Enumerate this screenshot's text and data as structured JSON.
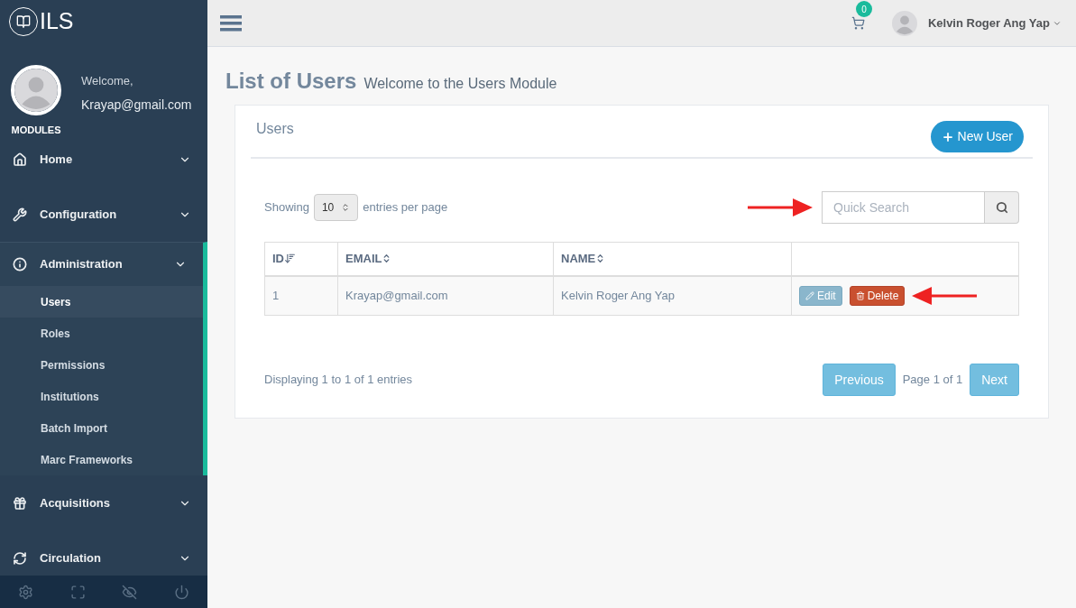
{
  "brand": "ILS",
  "profile": {
    "greeting": "Welcome,",
    "email": "Krayap@gmail.com",
    "section": "MODULES"
  },
  "nav": [
    {
      "label": "Home",
      "expanded": false
    },
    {
      "label": "Configuration",
      "expanded": false
    },
    {
      "label": "Administration",
      "expanded": true,
      "children": [
        {
          "label": "Users",
          "selected": true
        },
        {
          "label": "Roles",
          "selected": false
        },
        {
          "label": "Permissions",
          "selected": false
        },
        {
          "label": "Institutions",
          "selected": false
        },
        {
          "label": "Batch Import",
          "selected": false
        },
        {
          "label": "Marc Frameworks",
          "selected": false
        }
      ]
    },
    {
      "label": "Acquisitions",
      "expanded": false
    },
    {
      "label": "Circulation",
      "expanded": false
    }
  ],
  "topbar": {
    "cart_count": "0",
    "user_name": "Kelvin Roger Ang Yap"
  },
  "page": {
    "title": "List of Users",
    "subtitle": "Welcome to the Users Module"
  },
  "panel": {
    "title": "Users",
    "new_button": "New User"
  },
  "controls": {
    "showing_label": "Showing",
    "page_size": "10",
    "per_page_label": "entries per page",
    "search": {
      "placeholder": "Quick Search"
    }
  },
  "table": {
    "columns": [
      {
        "label": "ID",
        "sorted": true
      },
      {
        "label": "EMAIL",
        "sorted": false
      },
      {
        "label": "NAME",
        "sorted": false
      }
    ],
    "rows": [
      {
        "id": "1",
        "email": "Krayap@gmail.com",
        "name": "Kelvin Roger Ang Yap",
        "actions": [
          {
            "label": "Edit",
            "kind": "edit"
          },
          {
            "label": "Delete",
            "kind": "delete"
          }
        ]
      }
    ]
  },
  "footer": {
    "summary": "Displaying 1 to 1 of 1 entries",
    "previous": {
      "label": "Previous",
      "disabled": true
    },
    "page_info": "Page 1 of 1",
    "next": {
      "label": "Next",
      "disabled": true
    }
  }
}
